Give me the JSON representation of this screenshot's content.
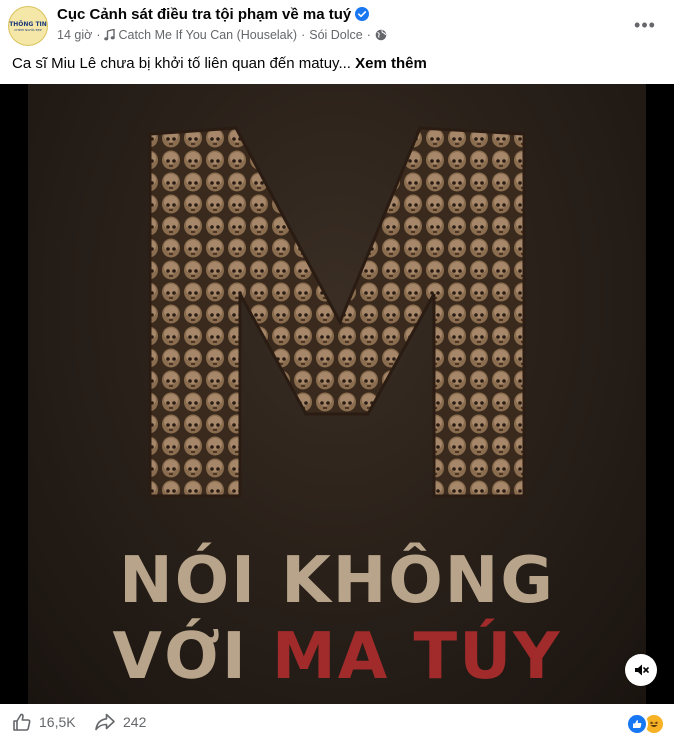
{
  "post": {
    "page_name": "Cục Cảnh sát điều tra tội phạm về ma tuý",
    "avatar_text_top": "THÔNG TIN",
    "avatar_text_bottom": "CHÍNH NGHĨA ĐẸP",
    "time": "14 giờ",
    "music": "Catch Me If You Can (Houselak)",
    "music_artist": "Sói Dolce",
    "separator": "·",
    "caption": "Ca sĩ Miu Lê chưa bị khởi tố liên quan đến matuy...",
    "see_more": "Xem thêm"
  },
  "media": {
    "letter": "M",
    "line1": "NÓI KHÔNG",
    "line2_prefix": "VỚI ",
    "line2_highlight": "MA TÚY",
    "highlight_color": "#a12b2b"
  },
  "footer": {
    "likes": "16,5K",
    "shares": "242"
  },
  "icons": {
    "verified": "verified-badge-icon",
    "music": "music-note-icon",
    "privacy": "globe-icon",
    "more": "more-options-icon",
    "mute": "mute-icon",
    "like": "thumbs-up-icon",
    "share": "share-arrow-icon"
  },
  "colors": {
    "brand_blue": "#1877f2",
    "secondary_text": "#65676b"
  }
}
